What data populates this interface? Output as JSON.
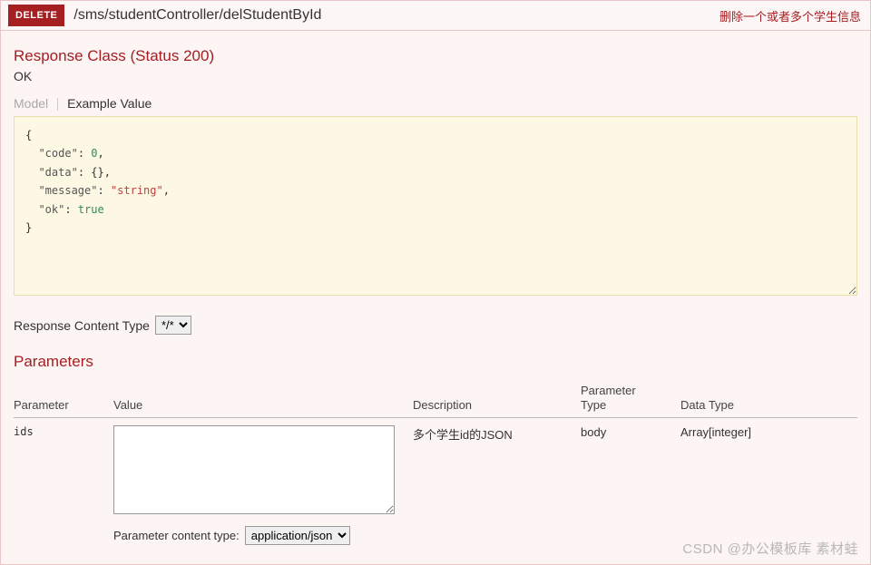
{
  "header": {
    "method": "DELETE",
    "path": "/sms/studentController/delStudentById",
    "description": "删除一个或者多个学生信息"
  },
  "response": {
    "class_title": "Response Class (Status 200)",
    "status_text": "OK",
    "tabs": {
      "model": "Model",
      "example": "Example Value"
    },
    "example": {
      "code_key": "\"code\"",
      "code_val": "0",
      "data_key": "\"data\"",
      "data_val": "{}",
      "message_key": "\"message\"",
      "message_val": "\"string\"",
      "ok_key": "\"ok\"",
      "ok_val": "true"
    },
    "content_type_label": "Response Content Type",
    "content_type_value": "*/*"
  },
  "parameters": {
    "heading": "Parameters",
    "columns": {
      "parameter": "Parameter",
      "value": "Value",
      "description": "Description",
      "ptype_l1": "Parameter",
      "ptype_l2": "Type",
      "datatype": "Data Type"
    },
    "row": {
      "name": "ids",
      "value": "",
      "description": "多个学生id的JSON",
      "ptype": "body",
      "datatype": "Array[integer]"
    },
    "content_type_label": "Parameter content type:",
    "content_type_value": "application/json"
  },
  "watermark": "CSDN @办公模板库 素材蛙"
}
